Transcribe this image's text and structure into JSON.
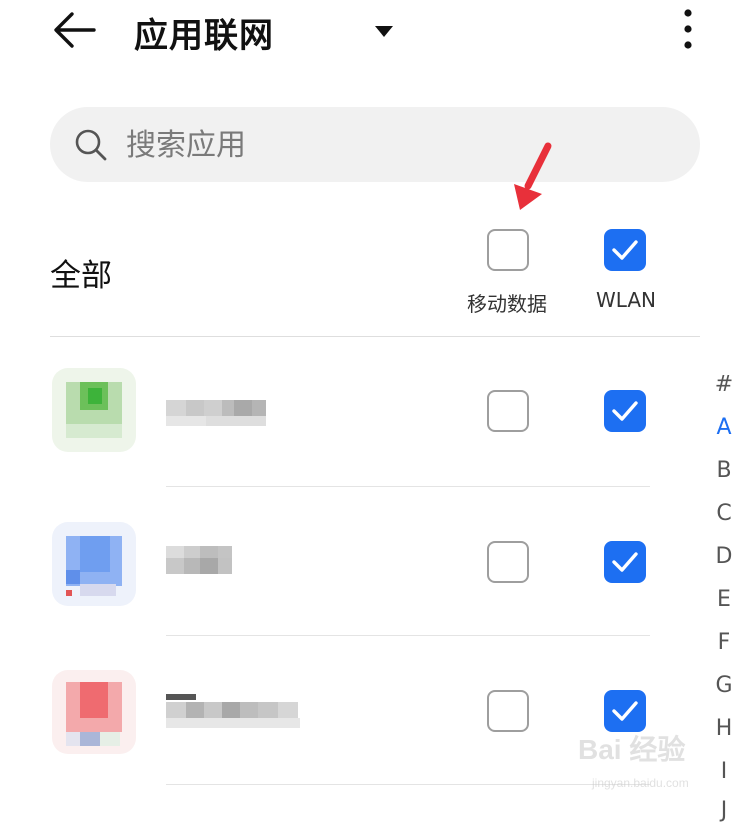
{
  "header": {
    "title": "应用联网",
    "back_icon": "arrow-left-icon",
    "dropdown_icon": "triangle-down-icon",
    "more_icon": "more-vertical-icon"
  },
  "search": {
    "placeholder": "搜索应用",
    "icon": "search-icon"
  },
  "filter": {
    "label": "全部",
    "mobile_data_label": "移动数据",
    "mobile_data_checked": false,
    "wlan_label": "WLAN",
    "wlan_checked": true
  },
  "apps": [
    {
      "name": "",
      "mobile_data_checked": false,
      "wlan_checked": true,
      "icon": "app-icon-green-pixelated"
    },
    {
      "name": "",
      "mobile_data_checked": false,
      "wlan_checked": true,
      "icon": "app-icon-blue-pixelated"
    },
    {
      "name": "",
      "mobile_data_checked": false,
      "wlan_checked": true,
      "icon": "app-icon-red-pixelated"
    }
  ],
  "alphabet_index": [
    "#",
    "A",
    "B",
    "C",
    "D",
    "E",
    "F",
    "G",
    "H",
    "I",
    "J"
  ],
  "alphabet_active": "A",
  "watermark": {
    "brand": "Bai 经验",
    "url": "jingyan.baidu.com"
  },
  "colors": {
    "accent": "#1d6ff2",
    "arrow": "#e8303a",
    "search_bg": "#f1f1f1"
  }
}
